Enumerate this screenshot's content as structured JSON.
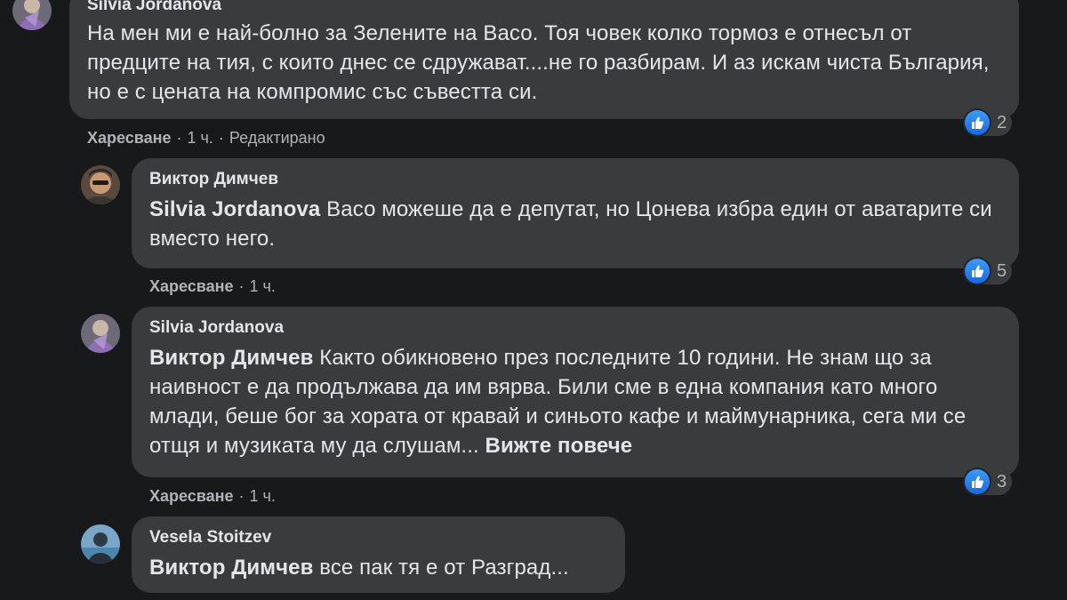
{
  "comments": [
    {
      "author": "Silvia Jordanova",
      "text": "На мен ми е най-болно за Зелените на Васо. Тоя човек колко тормоз е отнесъл от предците на тия, с които днес се сдружават....не го разбирам. И аз искам чиста България, но е с цената на компромис със съвестта си.",
      "like_label": "Харесване",
      "time": "1 ч.",
      "edited": "Редактирано",
      "reactions": "2"
    },
    {
      "author": "Виктор Димчев",
      "mention": "Silvia Jordanova",
      "text": "Васо можеше да е депутат, но Цонева избра един от аватарите си вместо него.",
      "like_label": "Харесване",
      "time": "1 ч.",
      "reactions": "5"
    },
    {
      "author": "Silvia Jordanova",
      "mention": "Виктор Димчев",
      "text": "Както обикновено през последните 10 години. Не знам що за наивност е да продължава да им вярва. Били сме в една компания като много млади, беше бог за хората от кравай и синьото кафе и маймунарника, сега ми се отщя и музиката му да слушам...",
      "see_more": "Вижте повече",
      "like_label": "Харесване",
      "time": "1 ч.",
      "reactions": "3"
    },
    {
      "author": "Vesela Stoitzev",
      "mention": "Виктор Димчев",
      "text": "все пак тя е от Разград..."
    }
  ],
  "icons": {
    "like": "thumbs-up-icon"
  },
  "colors": {
    "background": "#18191a",
    "bubble": "#3a3b3c",
    "like_blue": "#1877f2",
    "secondary_text": "#b0b3b8"
  }
}
